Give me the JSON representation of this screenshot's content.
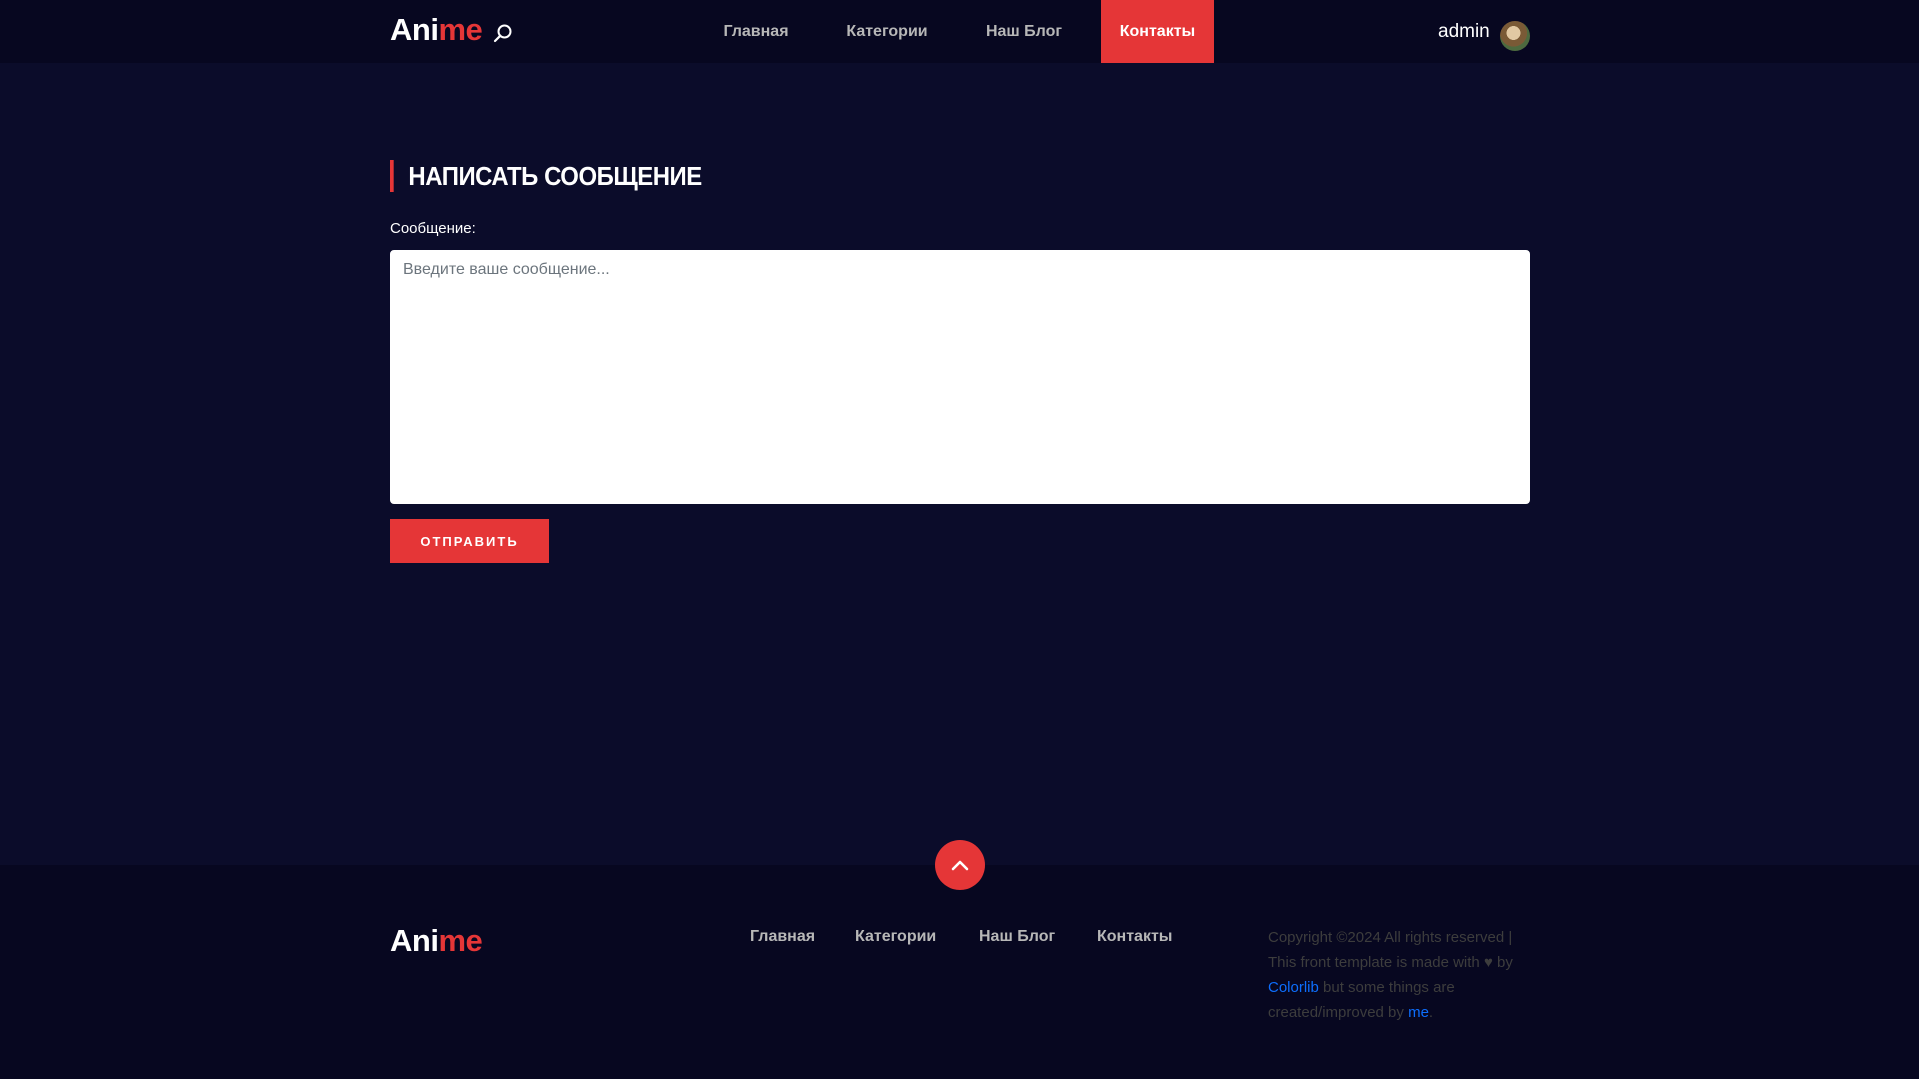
{
  "header": {
    "logo": {
      "part1": "Ani",
      "part2": "me"
    },
    "nav": [
      {
        "label": "Главная"
      },
      {
        "label": "Категории"
      },
      {
        "label": "Наш Блог"
      },
      {
        "label": "Контакты"
      }
    ],
    "user_name": "admin"
  },
  "main": {
    "section_title": "НАПИСАТЬ СООБЩЕНИЕ",
    "message_label": "Сообщение:",
    "message_placeholder": "Введите ваше сообщение...",
    "message_value": "",
    "submit_label": "ОТПРАВИТЬ"
  },
  "footer": {
    "logo": {
      "part1": "Ani",
      "part2": "me"
    },
    "nav": [
      {
        "label": "Главная"
      },
      {
        "label": "Категории"
      },
      {
        "label": "Наш Блог"
      },
      {
        "label": "Контакты"
      }
    ],
    "copyright": {
      "text1": "Copyright ©2024 All rights reserved | This front template is made with",
      "heart": "♥",
      "text2": "by",
      "link1": "Colorlib",
      "text3": "but some things are created/improved by",
      "link2": "me",
      "text4": "."
    }
  },
  "colors": {
    "accent": "#e53637",
    "background": "#0b0c2a",
    "header_bg": "#070720",
    "link": "#0d6efd"
  },
  "icons": {
    "search": "search-icon",
    "scroll_top": "chevron-up-icon",
    "avatar": "avatar"
  }
}
